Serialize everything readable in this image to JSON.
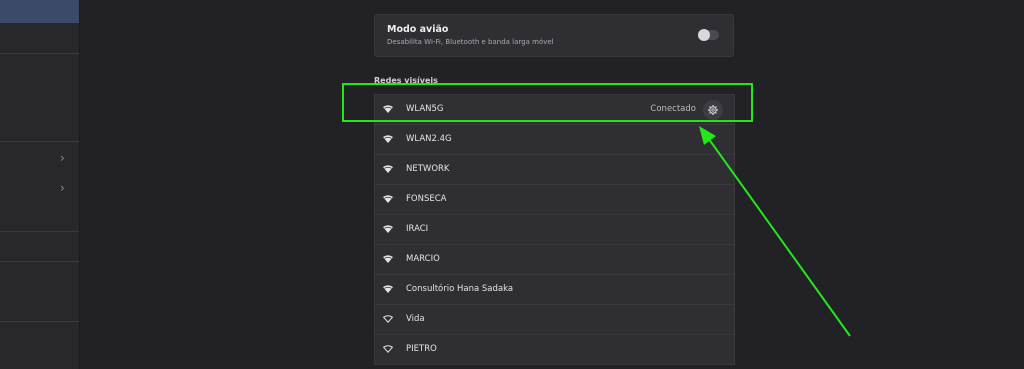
{
  "airplane_mode": {
    "title": "Modo avião",
    "subtitle": "Desabilita Wi-Fi, Bluetooth e banda larga móvel",
    "enabled": false
  },
  "networks_section": {
    "label": "Redes visíveis",
    "networks": [
      {
        "name": "WLAN5G",
        "status": "Conectado",
        "secured": true,
        "icon": "wifi-icon"
      },
      {
        "name": "WLAN2.4G",
        "status": "",
        "secured": true,
        "icon": "wifi-icon"
      },
      {
        "name": "NETWORK",
        "status": "",
        "secured": true,
        "icon": "wifi-icon"
      },
      {
        "name": "FONSECA",
        "status": "",
        "secured": true,
        "icon": "wifi-icon"
      },
      {
        "name": "IRACI",
        "status": "",
        "secured": true,
        "icon": "wifi-icon"
      },
      {
        "name": "MARCIO",
        "status": "",
        "secured": true,
        "icon": "wifi-icon"
      },
      {
        "name": "Consultório Hana Sadaka",
        "status": "",
        "secured": true,
        "icon": "wifi-icon"
      },
      {
        "name": "Vida",
        "status": "",
        "secured": false,
        "icon": "wifi-outline-icon"
      },
      {
        "name": "PIETRO",
        "status": "",
        "secured": false,
        "icon": "wifi-outline-icon"
      }
    ]
  },
  "colors": {
    "background": "#222226",
    "card": "#2e2e33",
    "sidebar_active": "#3b4a68",
    "annotation": "#22e81a"
  }
}
